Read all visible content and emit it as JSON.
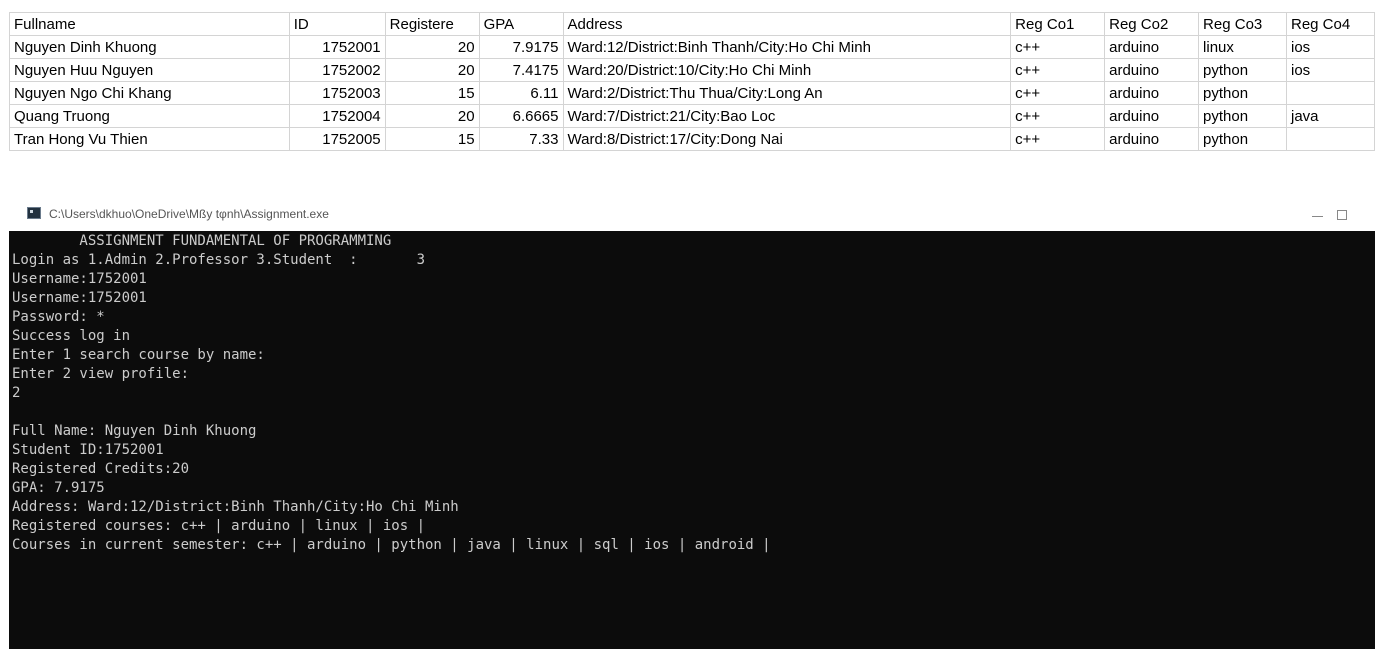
{
  "sheet": {
    "columns": [
      "Fullname",
      "ID",
      "Registere",
      "GPA",
      "Address",
      "Reg Co1",
      "Reg Co2",
      "Reg Co3",
      "Reg Co4"
    ],
    "rows": [
      [
        "Nguyen Dinh Khuong",
        "1752001",
        "20",
        "7.9175",
        "Ward:12/District:Binh Thanh/City:Ho Chi Minh",
        "c++",
        "arduino",
        "linux",
        "ios"
      ],
      [
        "Nguyen Huu Nguyen",
        "1752002",
        "20",
        "7.4175",
        "Ward:20/District:10/City:Ho Chi Minh",
        "c++",
        "arduino",
        "python",
        "ios"
      ],
      [
        "Nguyen Ngo Chi Khang",
        "1752003",
        "15",
        "6.11",
        "Ward:2/District:Thu Thua/City:Long An",
        "c++",
        "arduino",
        "python",
        ""
      ],
      [
        "Quang Truong",
        "1752004",
        "20",
        "6.6665",
        "Ward:7/District:21/City:Bao Loc",
        "c++",
        "arduino",
        "python",
        "java"
      ],
      [
        "Tran Hong Vu Thien",
        "1752005",
        "15",
        "7.33",
        "Ward:8/District:17/City:Dong Nai",
        "c++",
        "arduino",
        "python",
        ""
      ]
    ]
  },
  "window": {
    "title": "C:\\Users\\dkhuo\\OneDrive\\Mßy tφnh\\Assignment.exe",
    "icon": "console-app-icon",
    "minimize_icon": "minimize-icon",
    "maximize_icon": "maximize-icon"
  },
  "console": {
    "background": "#0c0c0c",
    "foreground": "#cccccc",
    "lines": [
      "        ASSIGNMENT FUNDAMENTAL OF PROGRAMMING",
      "Login as 1.Admin 2.Professor 3.Student  :       3",
      "Username:1752001",
      "Username:1752001",
      "Password: *",
      "Success log in",
      "Enter 1 search course by name:",
      "Enter 2 view profile:",
      "2",
      "",
      "Full Name: Nguyen Dinh Khuong",
      "Student ID:1752001",
      "Registered Credits:20",
      "GPA: 7.9175",
      "Address: Ward:12/District:Binh Thanh/City:Ho Chi Minh",
      "Registered courses: c++ | arduino | linux | ios |",
      "Courses in current semester: c++ | arduino | python | java | linux | sql | ios | android |"
    ]
  }
}
